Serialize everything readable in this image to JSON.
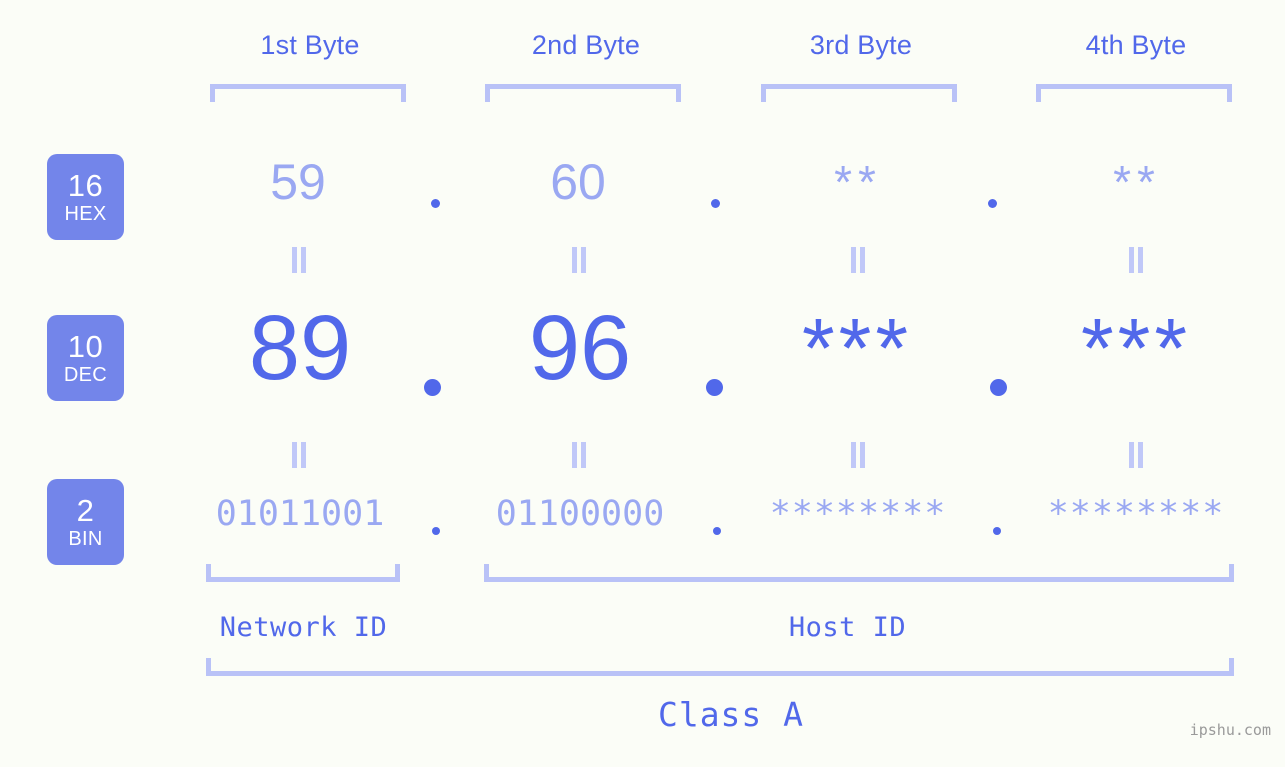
{
  "page": {
    "background_color": "#fbfdf7",
    "accent_color": "#5168ea",
    "muted_accent_color": "#9aa8f2",
    "bracket_color": "#b9c2f7",
    "badge_color": "#7385ea",
    "watermark": "ipshu.com"
  },
  "headers": [
    {
      "label": "1st Byte"
    },
    {
      "label": "2nd Byte"
    },
    {
      "label": "3rd Byte"
    },
    {
      "label": "4th Byte"
    }
  ],
  "radix_badges": [
    {
      "number": "16",
      "label": "HEX"
    },
    {
      "number": "10",
      "label": "DEC"
    },
    {
      "number": "2",
      "label": "BIN"
    }
  ],
  "rows": {
    "hex": {
      "radix": "16",
      "radix_label": "HEX",
      "values": [
        "59",
        "60",
        "**",
        "**"
      ],
      "separator": "."
    },
    "dec": {
      "radix": "10",
      "radix_label": "DEC",
      "values": [
        "89",
        "96",
        "***",
        "***"
      ],
      "separator": "."
    },
    "bin": {
      "radix": "2",
      "radix_label": "BIN",
      "values": [
        "01011001",
        "01100000",
        "********",
        "********"
      ],
      "separator": "."
    }
  },
  "equals_symbol": "=",
  "sections": {
    "network_id": "Network ID",
    "host_id": "Host ID",
    "class": "Class A"
  }
}
